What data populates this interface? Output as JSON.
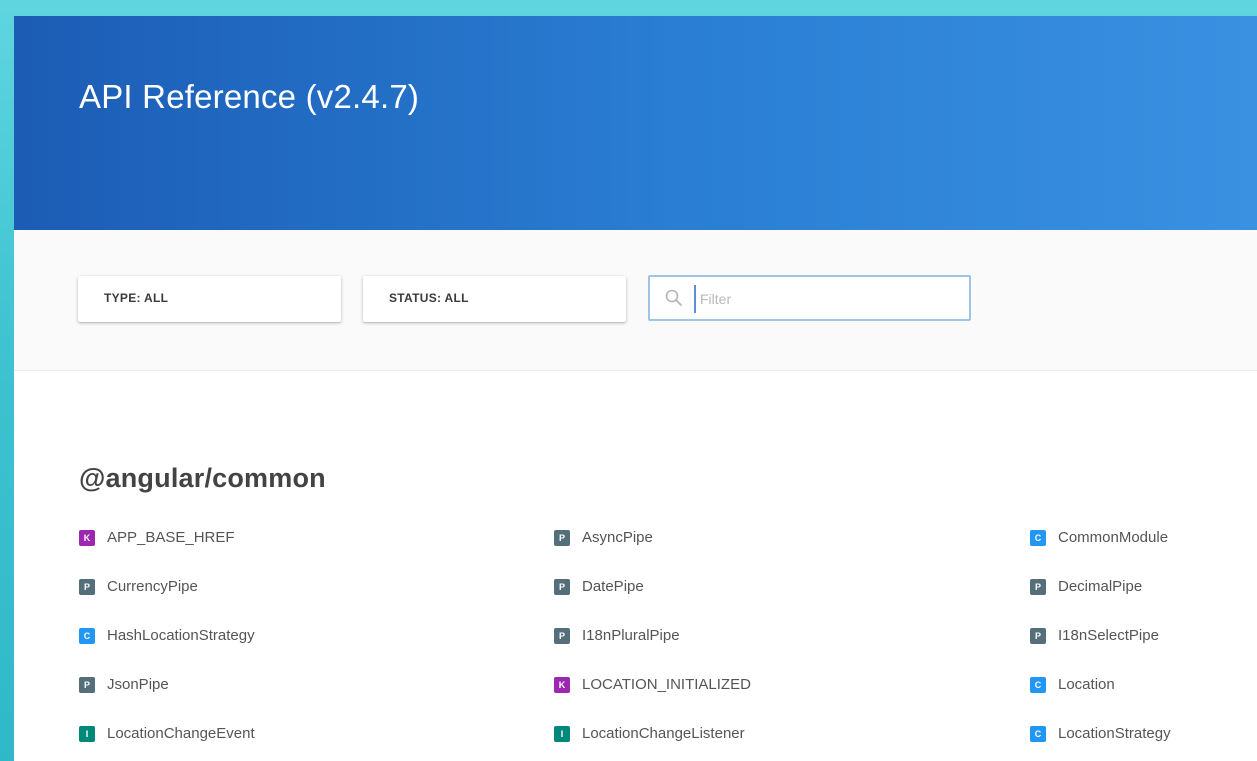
{
  "page": {
    "title": "API Reference (v2.4.7)"
  },
  "filters": {
    "type_label": "TYPE: ALL",
    "status_label": "STATUS: ALL",
    "search_placeholder": "Filter",
    "search_value": ""
  },
  "package": {
    "name": "@angular/common"
  },
  "badge_colors": {
    "K": "#9c27b0",
    "P": "#546e7a",
    "C": "#2196f3",
    "I": "#00897b"
  },
  "items": [
    {
      "name": "APP_BASE_HREF",
      "badge": "K",
      "icon": "const-icon"
    },
    {
      "name": "AsyncPipe",
      "badge": "P",
      "icon": "pipe-icon"
    },
    {
      "name": "CommonModule",
      "badge": "C",
      "icon": "class-icon"
    },
    {
      "name": "CurrencyPipe",
      "badge": "P",
      "icon": "pipe-icon"
    },
    {
      "name": "DatePipe",
      "badge": "P",
      "icon": "pipe-icon"
    },
    {
      "name": "DecimalPipe",
      "badge": "P",
      "icon": "pipe-icon"
    },
    {
      "name": "HashLocationStrategy",
      "badge": "C",
      "icon": "class-icon"
    },
    {
      "name": "I18nPluralPipe",
      "badge": "P",
      "icon": "pipe-icon"
    },
    {
      "name": "I18nSelectPipe",
      "badge": "P",
      "icon": "pipe-icon"
    },
    {
      "name": "JsonPipe",
      "badge": "P",
      "icon": "pipe-icon"
    },
    {
      "name": "LOCATION_INITIALIZED",
      "badge": "K",
      "icon": "const-icon"
    },
    {
      "name": "Location",
      "badge": "C",
      "icon": "class-icon"
    },
    {
      "name": "LocationChangeEvent",
      "badge": "I",
      "icon": "interface-icon"
    },
    {
      "name": "LocationChangeListener",
      "badge": "I",
      "icon": "interface-icon"
    },
    {
      "name": "LocationStrategy",
      "badge": "C",
      "icon": "class-icon"
    }
  ]
}
